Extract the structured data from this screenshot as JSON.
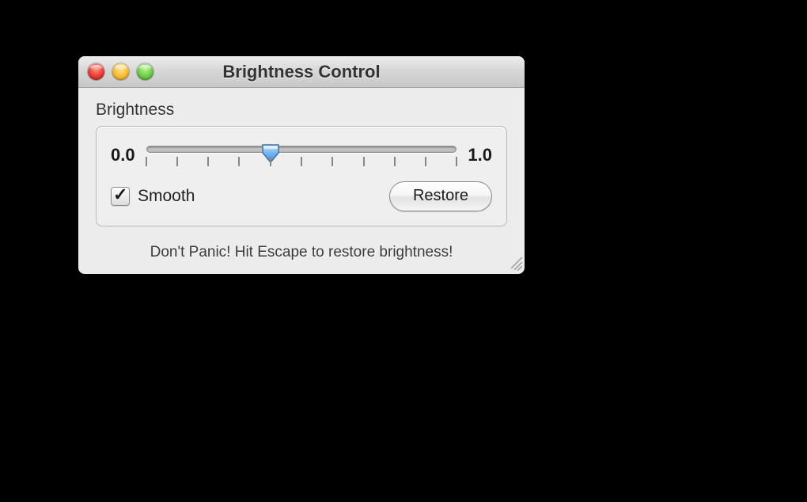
{
  "window": {
    "title": "Brightness Control"
  },
  "section": {
    "label": "Brightness"
  },
  "slider": {
    "min_label": "0.0",
    "max_label": "1.0",
    "min": 0.0,
    "max": 1.0,
    "value": 0.4,
    "tick_count": 11
  },
  "controls": {
    "smooth_label": "Smooth",
    "smooth_checked": true,
    "restore_label": "Restore"
  },
  "footer": {
    "hint": "Don't Panic!  Hit Escape to restore brightness!"
  }
}
